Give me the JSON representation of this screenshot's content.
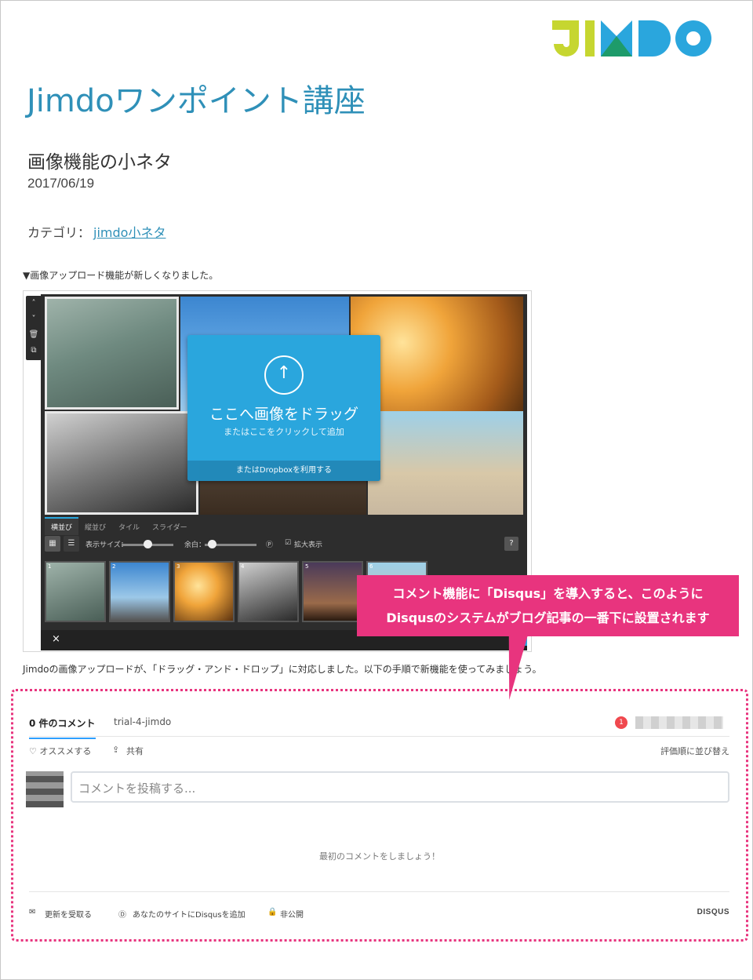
{
  "logo": {
    "text": "JIMDO",
    "colors": [
      "#c6d630",
      "#2aa6dd",
      "#1e9b6a"
    ]
  },
  "site_title": "Jimdoワンポイント講座",
  "post": {
    "title": "画像機能の小ネタ",
    "date": "2017/06/19",
    "category_label": "カテゴリ：",
    "category_link": "jimdo小ネタ"
  },
  "caption": "▼画像アップロード機能が新しくなりました。",
  "uploader": {
    "toolbar_icons": [
      "˄",
      "˅",
      "🗑",
      "⧉"
    ],
    "dialog_main": "ここへ画像をドラッグ",
    "dialog_sub": "またはここをクリックして追加",
    "dialog_dropbox": "またはDropboxを利用する",
    "tabs": [
      "横並び",
      "縦並び",
      "タイル",
      "スライダー"
    ],
    "option_size_label": "表示サイズ：",
    "option_margin_label": "余白：",
    "option_zoom_label": "拡大表示",
    "help": "?",
    "thumb_numbers": [
      "1",
      "2",
      "3",
      "4",
      "5",
      "6"
    ],
    "close": "×"
  },
  "body_text": "Jimdoの画像アップロードが、「ドラッグ・アンド・ドロップ」に対応しました。以下の手順で新機能を使ってみましょう。",
  "callout": {
    "line1": "コメント機能に「Disqus」を導入すると、このように",
    "line2": "Disqusのシステムがブログ記事の一番下に設置されます"
  },
  "disqus": {
    "tab_comments": "0 件のコメント",
    "tab_forum": "trial-4-jimdo",
    "badge": "1",
    "recommend": "♡ オススメする",
    "share": "共有",
    "sort": "評価順に並び替え",
    "input_placeholder": "コメントを投稿する...",
    "empty": "最初のコメントをしましょう！",
    "footer_subscribe": "更新を受取る",
    "footer_add": "あなたのサイトにDisqusを追加",
    "footer_private": "非公開",
    "brand": "DISQUS"
  }
}
